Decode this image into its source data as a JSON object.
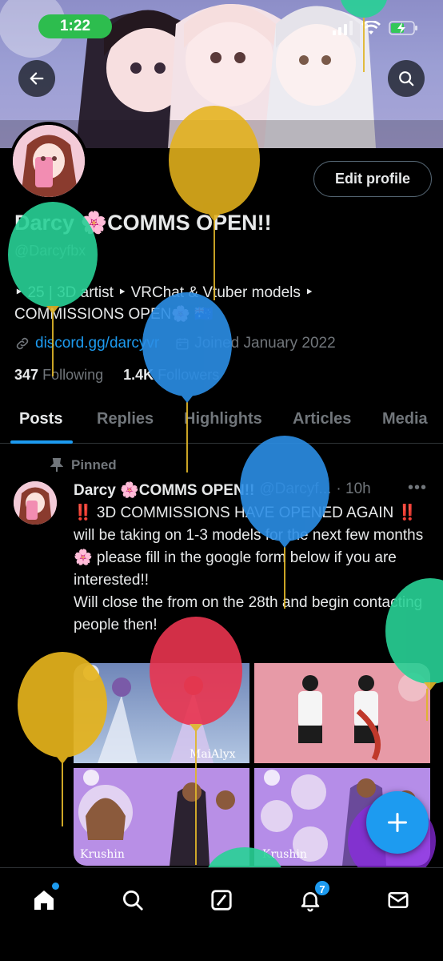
{
  "status_bar": {
    "time": "1:22"
  },
  "header": {
    "back_icon": "arrow-left-icon",
    "search_icon": "search-icon"
  },
  "profile": {
    "edit_profile_label": "Edit profile",
    "display_name": "Darcy 🌸COMMS OPEN!!",
    "handle": "@Darcyfbx",
    "bio_line1": "‣ 25 | 3D artist ‣ VRChat & Vtuber models ‣",
    "bio_line2": "COMMISSIONS OPEN🌸 🇦🇺",
    "link": "discord.gg/darcyvr",
    "joined": "Joined January 2022",
    "following_count": "347",
    "following_label": "Following",
    "followers_count": "1.4K",
    "followers_label": "Followers"
  },
  "tabs": [
    {
      "label": "Posts"
    },
    {
      "label": "Replies"
    },
    {
      "label": "Highlights"
    },
    {
      "label": "Articles"
    },
    {
      "label": "Media"
    }
  ],
  "post": {
    "pinned_label": "Pinned",
    "author_name": "Darcy 🌸COMMS OPEN!!",
    "author_handle": "@Darcyf...",
    "time": "· 10h",
    "more_icon": "more-horizontal-icon",
    "text": "‼️ 3D COMMISSIONS HAVE OPENED AGAIN ‼️\nwill be taking on 1-3 models for the next few months 🌸 please fill in the google form below if you are interested!!\nWill close the from on the 28th and begin contacting people then!",
    "media_captions": [
      "MaiAlyx",
      "",
      "Krushin",
      "Krushin"
    ]
  },
  "bottom_nav": {
    "items": [
      {
        "icon": "home-icon"
      },
      {
        "icon": "search-icon"
      },
      {
        "icon": "grok-icon"
      },
      {
        "icon": "bell-icon",
        "badge": "7"
      },
      {
        "icon": "mail-icon"
      }
    ]
  },
  "fab_icon": "plus-icon",
  "colors": {
    "accent": "#1d9bf0",
    "background": "#000000",
    "status_green": "#2dbd4e"
  }
}
